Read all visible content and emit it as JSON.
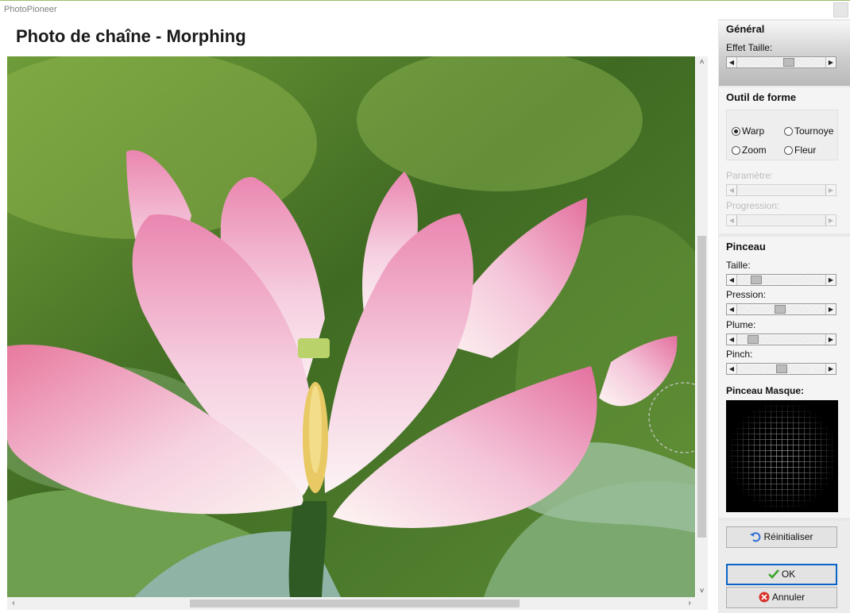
{
  "window": {
    "app_title": "PhotoPioneer"
  },
  "page": {
    "title": "Photo de chaîne - Morphing"
  },
  "colors": {
    "accent": "#0a64c8",
    "leaf_green": "#4f7c2d",
    "petal_pink": "#f2b6cf"
  },
  "general": {
    "title": "Général",
    "effet_taille": {
      "label": "Effet Taille:",
      "value": 0.6
    }
  },
  "outil": {
    "title": "Outil de forme",
    "options": {
      "warp": "Warp",
      "tournoye": "Tournoye",
      "zoom": "Zoom",
      "fleur": "Fleur"
    },
    "selected": "Warp",
    "parametre": {
      "label": "Paramètre:",
      "value": 0
    },
    "progression": {
      "label": "Progression:",
      "value": 0
    }
  },
  "pinceau": {
    "title": "Pinceau",
    "taille": {
      "label": "Taille:",
      "value": 0.18
    },
    "pression": {
      "label": "Pression:",
      "value": 0.48
    },
    "plume": {
      "label": "Plume:",
      "value": 0.13
    },
    "pinch": {
      "label": "Pinch:",
      "value": 0.5
    },
    "masque_title": "Pinceau Masque:"
  },
  "buttons": {
    "reinitialiser": "Réinitialiser",
    "ok": "OK",
    "annuler": "Annuler"
  }
}
